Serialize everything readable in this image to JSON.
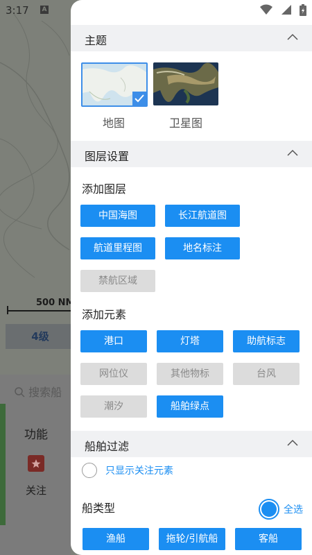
{
  "status": {
    "time": "3:17",
    "indicator": "A"
  },
  "background": {
    "scale_label": "500 NM",
    "level": "4级",
    "search_placeholder": "搜索船",
    "function_label": "功能",
    "favorite_label": "关注"
  },
  "theme": {
    "title": "主题",
    "options": [
      {
        "label": "地图",
        "selected": true
      },
      {
        "label": "卫星图",
        "selected": false
      }
    ]
  },
  "layers": {
    "title": "图层设置",
    "add_layer_label": "添加图层",
    "layer_buttons": [
      {
        "label": "中国海图",
        "active": true
      },
      {
        "label": "长江航道图",
        "active": true
      },
      {
        "label": "航道里程图",
        "active": true
      },
      {
        "label": "地名标注",
        "active": true
      },
      {
        "label": "禁航区域",
        "active": false
      }
    ],
    "add_element_label": "添加元素",
    "element_buttons": [
      {
        "label": "港口",
        "active": true
      },
      {
        "label": "灯塔",
        "active": true
      },
      {
        "label": "助航标志",
        "active": true
      },
      {
        "label": "网位仪",
        "active": false
      },
      {
        "label": "其他物标",
        "active": false
      },
      {
        "label": "台风",
        "active": false
      },
      {
        "label": "潮汐",
        "active": false
      },
      {
        "label": "船舶绿点",
        "active": true
      }
    ]
  },
  "filter": {
    "title": "船舶过滤",
    "only_favorites_label": "只显示关注元素",
    "ship_type_label": "船类型",
    "select_all_label": "全选",
    "ship_types": [
      {
        "label": "渔船",
        "active": true
      },
      {
        "label": "拖轮/引航船",
        "active": true
      },
      {
        "label": "客船",
        "active": true
      }
    ]
  },
  "colors": {
    "accent": "#1b8ef2",
    "inactive": "#dcdcdc",
    "section_bg": "#f0f1f3"
  }
}
